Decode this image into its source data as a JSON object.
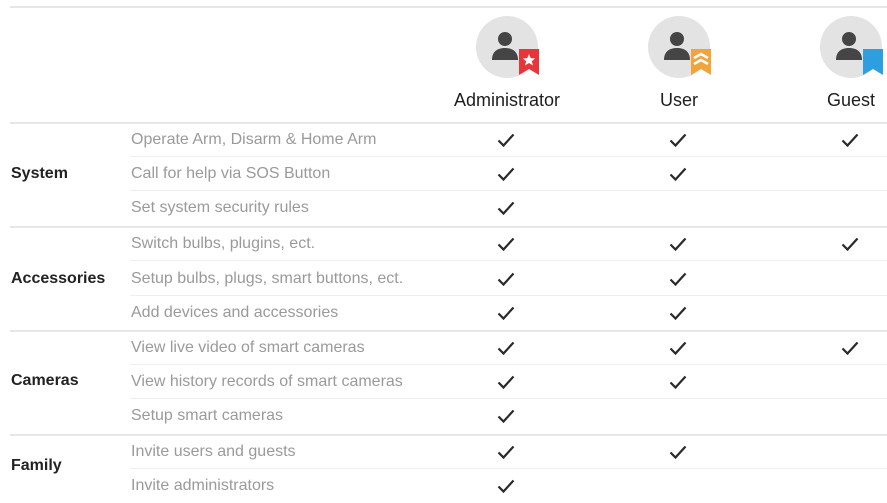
{
  "roles": [
    {
      "name": "Administrator",
      "badge": "star-ribbon-icon",
      "color": "#e8353b"
    },
    {
      "name": "User",
      "badge": "chevron-ribbon-icon",
      "color": "#f2a33a"
    },
    {
      "name": "Guest",
      "badge": "ribbon-icon",
      "color": "#2d9ee0"
    }
  ],
  "sections": [
    {
      "label": "System",
      "rows": [
        {
          "feature": "Operate Arm, Disarm & Home Arm",
          "admin": true,
          "user": true,
          "guest": true
        },
        {
          "feature": "Call for help via SOS Button",
          "admin": true,
          "user": true,
          "guest": false
        },
        {
          "feature": "Set system security rules",
          "admin": true,
          "user": false,
          "guest": false
        }
      ]
    },
    {
      "label": "Accessories",
      "rows": [
        {
          "feature": "Switch bulbs, plugins, ect.",
          "admin": true,
          "user": true,
          "guest": true
        },
        {
          "feature": "Setup bulbs, plugs, smart buttons, ect.",
          "admin": true,
          "user": true,
          "guest": false
        },
        {
          "feature": "Add devices and accessories",
          "admin": true,
          "user": true,
          "guest": false
        }
      ]
    },
    {
      "label": "Cameras",
      "rows": [
        {
          "feature": "View live video of smart cameras",
          "admin": true,
          "user": true,
          "guest": true
        },
        {
          "feature": "View history records of smart cameras",
          "admin": true,
          "user": true,
          "guest": false
        },
        {
          "feature": "Setup smart cameras",
          "admin": true,
          "user": false,
          "guest": false
        }
      ]
    },
    {
      "label": "Family",
      "rows": [
        {
          "feature": "Invite users and guests",
          "admin": true,
          "user": true,
          "guest": false
        },
        {
          "feature": "Invite administrators",
          "admin": true,
          "user": false,
          "guest": false
        }
      ]
    }
  ]
}
